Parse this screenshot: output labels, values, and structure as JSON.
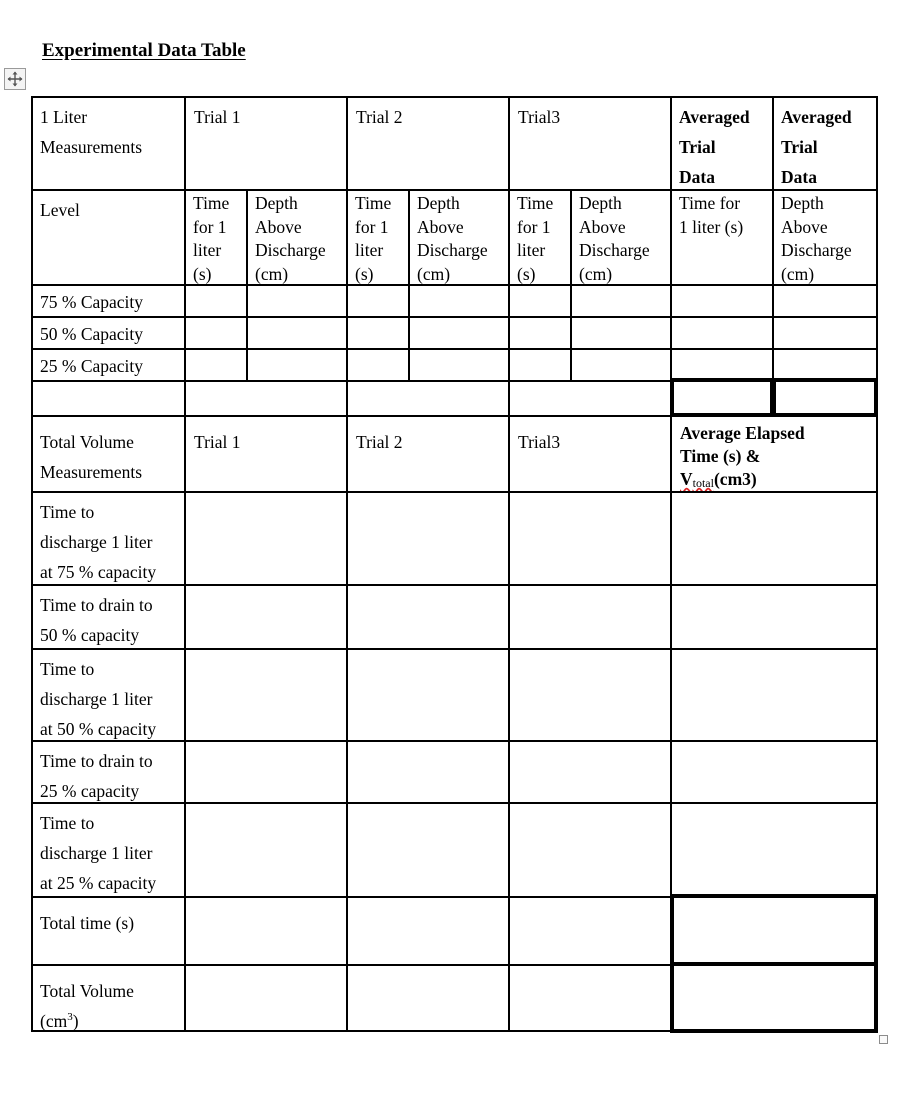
{
  "title": "Experimental Data Table",
  "icons": {
    "move_handle": "four-arrow-move-icon",
    "resize_handle": "square-resize-icon"
  },
  "section1": {
    "header": {
      "label": "1 Liter Measurements",
      "label_lines": [
        "1 Liter",
        "Measurements"
      ],
      "trials": [
        "Trial 1",
        "Trial 2",
        "Trial3"
      ],
      "averaged_lines": [
        "Averaged",
        "Trial",
        "Data"
      ]
    },
    "subheader": {
      "label": "Level",
      "time_lines": [
        "Time",
        "for 1",
        "liter",
        "(s)"
      ],
      "depth_lines": [
        "Depth",
        "Above",
        "Discharge",
        "(cm)"
      ],
      "avg_time_lines": [
        "Time for",
        "1 liter (s)"
      ],
      "avg_depth_lines": [
        "Depth",
        "Above",
        "Discharge",
        "(cm)"
      ]
    },
    "rows": [
      {
        "label": "75 % Capacity",
        "values": [
          "",
          "",
          "",
          "",
          "",
          "",
          "",
          ""
        ]
      },
      {
        "label": "50 % Capacity",
        "values": [
          "",
          "",
          "",
          "",
          "",
          "",
          "",
          ""
        ]
      },
      {
        "label": "25 % Capacity",
        "values": [
          "",
          "",
          "",
          "",
          "",
          "",
          "",
          ""
        ]
      }
    ]
  },
  "section2": {
    "header": {
      "label_lines": [
        "Total Volume",
        "Measurements"
      ],
      "trials": [
        "Trial 1",
        "Trial 2",
        "Trial3"
      ],
      "average_lines": [
        "Average Elapsed",
        "Time (s) &"
      ],
      "average_v": "V",
      "average_v_sub": "total",
      "average_unit": "(cm3)"
    },
    "rows": [
      {
        "label_lines": [
          "Time to",
          "discharge 1 liter",
          "at 75 % capacity"
        ],
        "values": [
          "",
          "",
          "",
          ""
        ]
      },
      {
        "label_lines": [
          "Time to drain to",
          "50 % capacity"
        ],
        "values": [
          "",
          "",
          "",
          ""
        ]
      },
      {
        "label_lines": [
          "Time to",
          "discharge 1 liter",
          "at 50 % capacity"
        ],
        "values": [
          "",
          "",
          "",
          ""
        ]
      },
      {
        "label_lines": [
          "Time to drain to",
          "25 % capacity"
        ],
        "values": [
          "",
          "",
          "",
          ""
        ]
      },
      {
        "label_lines": [
          "Time to",
          "discharge 1 liter",
          "at 25 % capacity"
        ],
        "values": [
          "",
          "",
          "",
          ""
        ]
      },
      {
        "label_lines": [
          "Total time (s)"
        ],
        "values": [
          "",
          "",
          "",
          ""
        ]
      },
      {
        "label_lines": [
          "Total Volume"
        ],
        "unit_base": "(cm",
        "unit_sup": "3",
        "unit_close": ")",
        "values": [
          "",
          "",
          "",
          ""
        ]
      }
    ]
  }
}
